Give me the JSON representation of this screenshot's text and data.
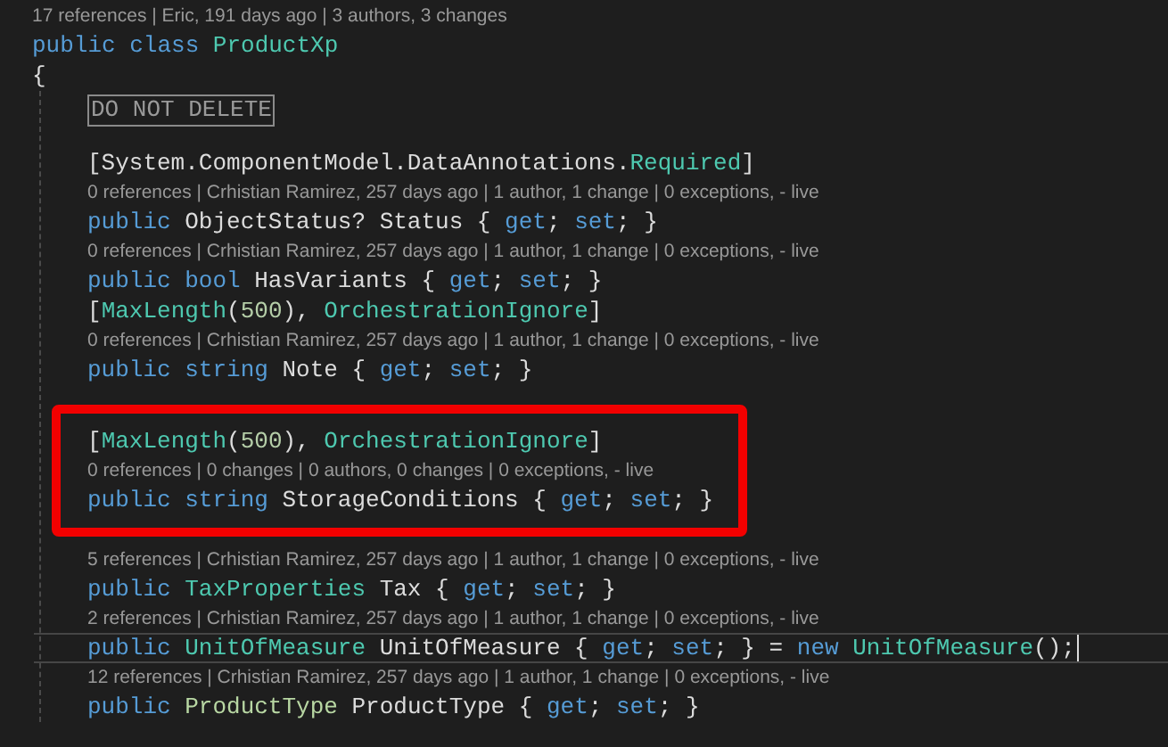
{
  "header": [
    {
      "kind": "lens",
      "text": "17 references | Eric, 191 days ago | 3 authors, 3 changes"
    },
    {
      "kind": "code",
      "current": false,
      "tokens": [
        {
          "text": "public class ",
          "kind": "keyword"
        },
        {
          "text": "ProductXp",
          "kind": "type"
        }
      ]
    },
    {
      "kind": "code",
      "current": false,
      "tokens": [
        {
          "text": "{",
          "kind": "plain"
        }
      ]
    }
  ],
  "body": [
    {
      "kind": "collapsed",
      "text": "DO NOT DELETE"
    },
    {
      "kind": "blank"
    },
    {
      "kind": "code",
      "current": false,
      "tokens": [
        {
          "text": "[System.ComponentModel.DataAnnotations.",
          "kind": "plain"
        },
        {
          "text": "Required",
          "kind": "type"
        },
        {
          "text": "]",
          "kind": "plain"
        }
      ]
    },
    {
      "kind": "lens",
      "text": "0 references | Crhistian Ramirez, 257 days ago | 1 author, 1 change | 0 exceptions, - live"
    },
    {
      "kind": "code",
      "current": false,
      "tokens": [
        {
          "text": "public ",
          "kind": "keyword"
        },
        {
          "text": "ObjectStatus? Status { ",
          "kind": "plain"
        },
        {
          "text": "get",
          "kind": "keyword"
        },
        {
          "text": "; ",
          "kind": "plain"
        },
        {
          "text": "set",
          "kind": "keyword"
        },
        {
          "text": "; }",
          "kind": "plain"
        }
      ]
    },
    {
      "kind": "lens",
      "text": "0 references | Crhistian Ramirez, 257 days ago | 1 author, 1 change | 0 exceptions, - live"
    },
    {
      "kind": "code",
      "current": false,
      "tokens": [
        {
          "text": "public bool ",
          "kind": "keyword"
        },
        {
          "text": "HasVariants { ",
          "kind": "plain"
        },
        {
          "text": "get",
          "kind": "keyword"
        },
        {
          "text": "; ",
          "kind": "plain"
        },
        {
          "text": "set",
          "kind": "keyword"
        },
        {
          "text": "; }",
          "kind": "plain"
        }
      ]
    },
    {
      "kind": "code",
      "current": false,
      "tokens": [
        {
          "text": "[",
          "kind": "plain"
        },
        {
          "text": "MaxLength",
          "kind": "type"
        },
        {
          "text": "(",
          "kind": "plain"
        },
        {
          "text": "500",
          "kind": "number"
        },
        {
          "text": "), ",
          "kind": "plain"
        },
        {
          "text": "OrchestrationIgnore",
          "kind": "type"
        },
        {
          "text": "]",
          "kind": "plain"
        }
      ]
    },
    {
      "kind": "lens",
      "text": "0 references | Crhistian Ramirez, 257 days ago | 1 author, 1 change | 0 exceptions, - live"
    },
    {
      "kind": "code",
      "current": false,
      "tokens": [
        {
          "text": "public string ",
          "kind": "keyword"
        },
        {
          "text": "Note { ",
          "kind": "plain"
        },
        {
          "text": "get",
          "kind": "keyword"
        },
        {
          "text": "; ",
          "kind": "plain"
        },
        {
          "text": "set",
          "kind": "keyword"
        },
        {
          "text": "; }",
          "kind": "plain"
        }
      ]
    },
    {
      "kind": "blank"
    },
    {
      "kind": "highlight",
      "children": [
        {
          "kind": "code",
          "current": false,
          "tokens": [
            {
              "text": "[",
              "kind": "plain"
            },
            {
              "text": "MaxLength",
              "kind": "type"
            },
            {
              "text": "(",
              "kind": "plain"
            },
            {
              "text": "500",
              "kind": "number"
            },
            {
              "text": "), ",
              "kind": "plain"
            },
            {
              "text": "OrchestrationIgnore",
              "kind": "type"
            },
            {
              "text": "]",
              "kind": "plain"
            }
          ]
        },
        {
          "kind": "lens",
          "text": "0 references | 0 changes | 0 authors, 0 changes | 0 exceptions, - live"
        },
        {
          "kind": "code",
          "current": false,
          "tokens": [
            {
              "text": "public string ",
              "kind": "keyword"
            },
            {
              "text": "StorageConditions { ",
              "kind": "plain"
            },
            {
              "text": "get",
              "kind": "keyword"
            },
            {
              "text": "; ",
              "kind": "plain"
            },
            {
              "text": "set",
              "kind": "keyword"
            },
            {
              "text": "; }",
              "kind": "plain"
            }
          ]
        }
      ]
    },
    {
      "kind": "lens",
      "text": "5 references | Crhistian Ramirez, 257 days ago | 1 author, 1 change | 0 exceptions, - live"
    },
    {
      "kind": "code",
      "current": false,
      "tokens": [
        {
          "text": "public ",
          "kind": "keyword"
        },
        {
          "text": "TaxProperties",
          "kind": "type"
        },
        {
          "text": " Tax { ",
          "kind": "plain"
        },
        {
          "text": "get",
          "kind": "keyword"
        },
        {
          "text": "; ",
          "kind": "plain"
        },
        {
          "text": "set",
          "kind": "keyword"
        },
        {
          "text": "; }",
          "kind": "plain"
        }
      ]
    },
    {
      "kind": "lens",
      "text": "2 references | Crhistian Ramirez, 257 days ago | 1 author, 1 change | 0 exceptions, - live"
    },
    {
      "kind": "code",
      "current": true,
      "tokens": [
        {
          "text": "public ",
          "kind": "keyword"
        },
        {
          "text": "UnitOfMeasure",
          "kind": "type"
        },
        {
          "text": " UnitOfMeasure { ",
          "kind": "plain"
        },
        {
          "text": "get",
          "kind": "keyword"
        },
        {
          "text": "; ",
          "kind": "plain"
        },
        {
          "text": "set",
          "kind": "keyword"
        },
        {
          "text": "; } = ",
          "kind": "plain"
        },
        {
          "text": "new ",
          "kind": "keyword"
        },
        {
          "text": "UnitOfMeasure",
          "kind": "type"
        },
        {
          "text": "();",
          "kind": "plain"
        }
      ]
    },
    {
      "kind": "lens",
      "text": "12 references | Crhistian Ramirez, 257 days ago | 1 author, 1 change | 0 exceptions, - live"
    },
    {
      "kind": "code",
      "current": false,
      "tokens": [
        {
          "text": "public ",
          "kind": "keyword"
        },
        {
          "text": "ProductType",
          "kind": "enum"
        },
        {
          "text": " ProductType { ",
          "kind": "plain"
        },
        {
          "text": "get",
          "kind": "keyword"
        },
        {
          "text": "; ",
          "kind": "plain"
        },
        {
          "text": "set",
          "kind": "keyword"
        },
        {
          "text": "; }",
          "kind": "plain"
        }
      ]
    }
  ]
}
